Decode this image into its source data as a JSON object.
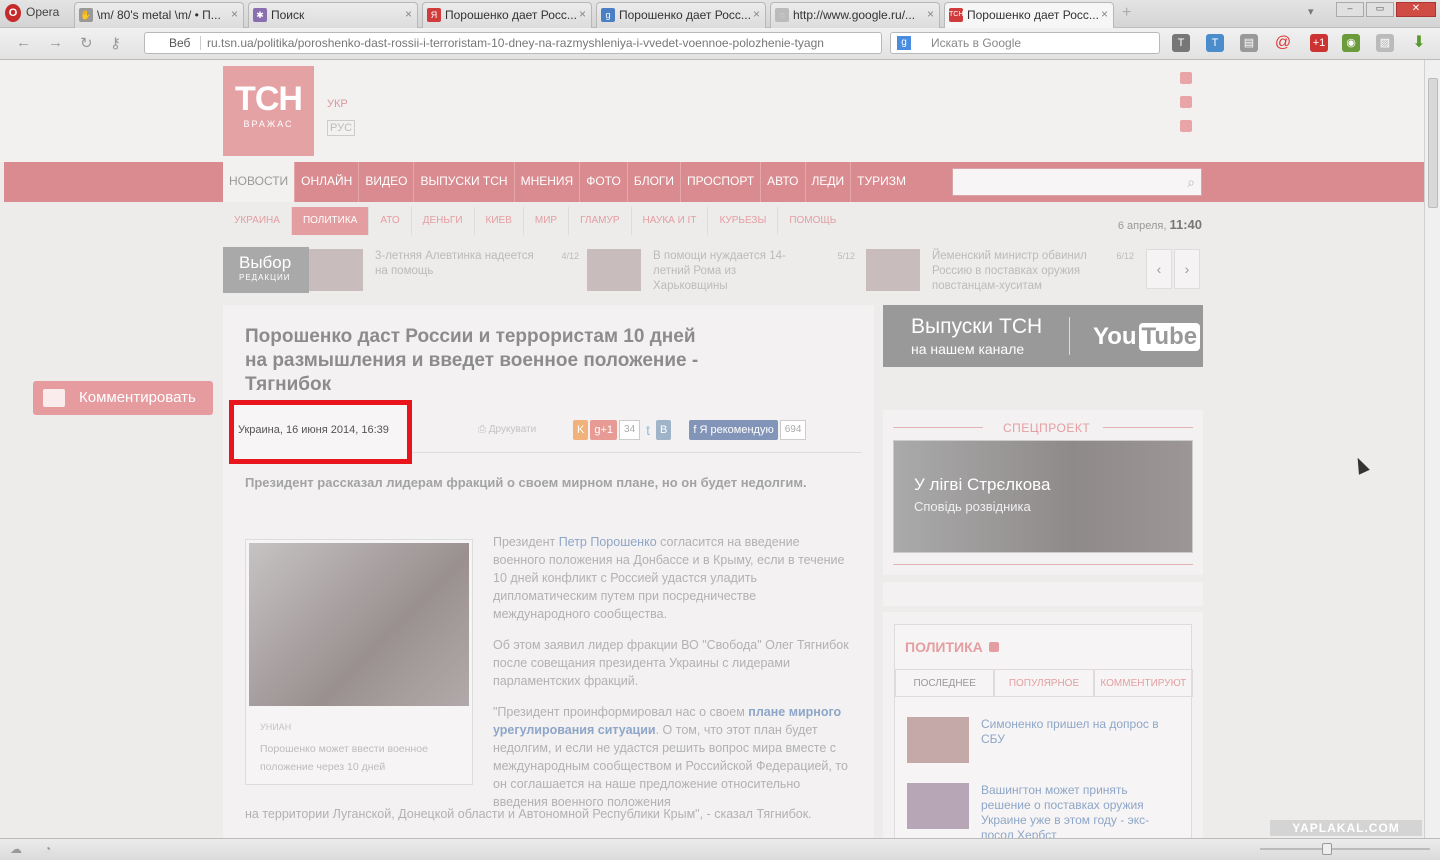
{
  "browser": {
    "app_name": "Opera",
    "tabs": [
      {
        "label": "\\m/ 80's metal \\m/ • П..."
      },
      {
        "label": "Поиск"
      },
      {
        "label": "Порошенко дает Росс..."
      },
      {
        "label": "Порошенко дает Росс..."
      },
      {
        "label": "http://www.google.ru/..."
      },
      {
        "label": "Порошенко дает Росс..."
      }
    ],
    "web_label": "Веб",
    "url": "ru.tsn.ua/politika/poroshenko-dast-rossii-i-terroristam-10-dney-na-razmyshleniya-i-vvedet-voennoe-polozhenie-tyagn",
    "search_placeholder": "Искать в Google"
  },
  "site": {
    "logo_main": "ТСН",
    "logo_sub": "ВРАЖАС",
    "lang_ukr": "УКР",
    "lang_rus": "РУС",
    "nav": [
      "НОВОСТИ",
      "ОНЛАЙН",
      "ВИДЕО",
      "ВЫПУСКИ ТСН",
      "МНЕНИЯ",
      "ФОТО",
      "БЛОГИ",
      "ПРОСПОРТ",
      "АВТО",
      "ЛЕДИ",
      "ТУРИЗМ"
    ],
    "subnav": [
      "УКРАИНА",
      "ПОЛИТИКА",
      "АТО",
      "ДЕНЬГИ",
      "КИЕВ",
      "МИР",
      "ГЛАМУР",
      "НАУКА И IT",
      "КУРЬЕЗЫ",
      "ПОМОЩЬ"
    ],
    "date_label": "6 апреля,",
    "time_label": "11:40"
  },
  "picks": {
    "title": "Выбор",
    "subtitle": "РЕДАКЦИИ",
    "items": [
      {
        "text": "3-летняя Алевтинка надеется на помощь",
        "count": "4/12"
      },
      {
        "text": "В помощи нуждается 14-летний Рома из Харьковщины",
        "count": "5/12"
      },
      {
        "text": "Йеменский министр обвинил Россию в поставках оружия повстанцам-хуситам",
        "count": "6/12"
      }
    ]
  },
  "comment_button": "Комментировать",
  "article": {
    "title": "Порошенко даст России и террористам 10 дней на размышления и введет военное положение - Тягнибок",
    "dateline": "Украина, 16 июня 2014, 16:39",
    "print": "Друкувати",
    "social": {
      "ok": "K",
      "gplus": "g+1",
      "gplus_count": "34",
      "fb_label": "Я рекомендую",
      "fb_count": "694"
    },
    "lead": "Президент рассказал лидерам фракций о своем мирном плане, но он будет недолгим.",
    "photo_source": "УНИАН",
    "photo_caption": "Порошенко может ввести военное положение через 10 дней",
    "p1_pre": "Президент ",
    "p1_link": "Петр Порошенко",
    "p1_post": " согласится на введение военного положения на Донбассе и в Крыму, если в течение 10 дней конфликт с Россией удастся уладить дипломатическим путем при посредничестве международного сообщества.",
    "p2": "Об этом заявил лидер фракции ВО \"Свобода\" Олег Тягнибок после совещания президента Украины с лидерами парламентских фракций.",
    "p3_pre": "\"Президент проинформировал нас о своем ",
    "p3_link": "плане мирного урегулирования ситуации",
    "p3_post": ". О том, что этот план будет недолгим, и если не удастся решить вопрос мира вместе с международным сообществом и Российской Федерацией, то он соглашается на наше предложение относительно введения военного положения",
    "p3_last": "на территории Луганской, Донецкой области и Автономной Республики Крым\", - сказал Тягнибок."
  },
  "right": {
    "yt_line1": "Выпуски ТСН",
    "yt_line2": "на нашем канале",
    "yt_logo_a": "You",
    "yt_logo_b": "Tube",
    "spec_label": "СПЕЦПРОЕКТ",
    "spec_title": "У лігві Стрєлкова",
    "spec_sub": "Сповідь розвідника",
    "polit_title": "ПОЛИТИКА",
    "polit_tabs": [
      "ПОСЛЕДНЕЕ",
      "ПОПУЛЯРНОЕ",
      "КОММЕНТИРУЮТ"
    ],
    "news": [
      {
        "text": "Симоненко пришел на допрос в СБУ"
      },
      {
        "text": "Вашингтон может принять решение о поставках оружия Украине уже в этом году - экс-посол Хербст"
      }
    ]
  },
  "watermark": "YAPLAKAL.COM"
}
